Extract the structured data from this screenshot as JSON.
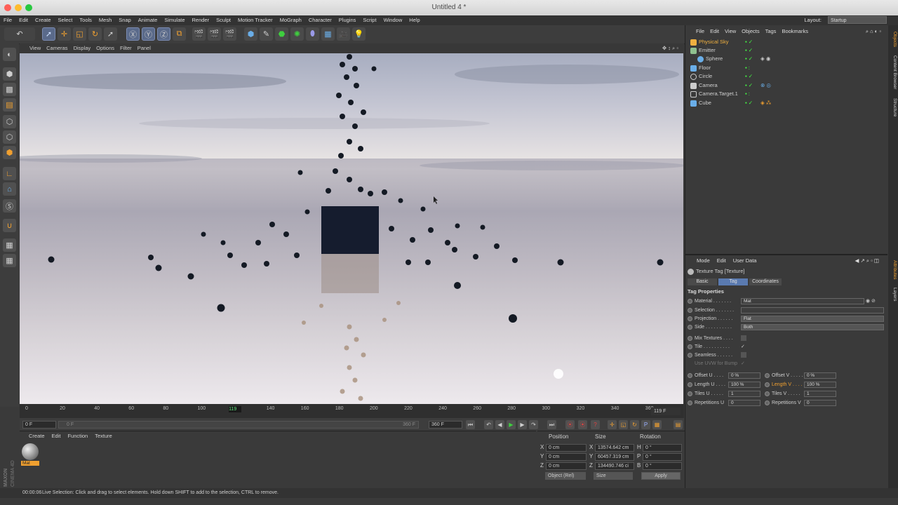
{
  "window": {
    "title": "Untitled 4 *"
  },
  "menu": [
    "File",
    "Edit",
    "Create",
    "Select",
    "Tools",
    "Mesh",
    "Snap",
    "Animate",
    "Simulate",
    "Render",
    "Sculpt",
    "Motion Tracker",
    "MoGraph",
    "Character",
    "Plugins",
    "Script",
    "Window",
    "Help"
  ],
  "layout": {
    "label": "Layout:",
    "value": "Startup"
  },
  "viewport_menu": [
    "View",
    "Cameras",
    "Display",
    "Options",
    "Filter",
    "Panel"
  ],
  "timeline": {
    "ticks": [
      "0",
      "20",
      "40",
      "60",
      "80",
      "100",
      "120",
      "140",
      "160",
      "180",
      "200",
      "220",
      "240",
      "260",
      "280",
      "300",
      "320",
      "340",
      "360"
    ],
    "current_marker": "119",
    "frame_display": "119 F",
    "current_frame": 119,
    "max_frame": 360
  },
  "playbar": {
    "start_field": "0 F",
    "range_start": "0 F",
    "range_end": "360 F",
    "end_field": "360 F"
  },
  "material_manager": {
    "menu": [
      "Create",
      "Edit",
      "Function",
      "Texture"
    ],
    "material_name": "Mat"
  },
  "coordinates": {
    "headers": [
      "Position",
      "Size",
      "Rotation"
    ],
    "rows": [
      {
        "axis": "X",
        "pos": "0 cm",
        "size_axis": "X",
        "size": "13574.642 cm",
        "rot_axis": "H",
        "rot": "0 °"
      },
      {
        "axis": "Y",
        "pos": "0 cm",
        "size_axis": "Y",
        "size": "60457.319 cm",
        "rot_axis": "P",
        "rot": "0 °"
      },
      {
        "axis": "Z",
        "pos": "0 cm",
        "size_axis": "Z",
        "size": "134490.746 ci",
        "rot_axis": "B",
        "rot": "0 °"
      }
    ],
    "mode_select": "Object (Rel)",
    "size_select": "Size",
    "apply": "Apply"
  },
  "status": {
    "time": "00:00:06",
    "message": "Live Selection: Click and drag to select elements. Hold down SHIFT to add to the selection, CTRL to remove."
  },
  "brand": {
    "line1": "MAXON",
    "line2": "CINEMA 4D"
  },
  "object_manager": {
    "menu": [
      "File",
      "Edit",
      "View",
      "Objects",
      "Tags",
      "Bookmarks"
    ],
    "objects": [
      {
        "name": "Physical Sky",
        "color": "#f0b040",
        "highlight": true
      },
      {
        "name": "Emitter",
        "color": "#8fc08f"
      },
      {
        "name": "Sphere",
        "color": "#6aaee8"
      },
      {
        "name": "Floor",
        "color": "#6aaee8"
      },
      {
        "name": "Circle",
        "color": "#cccccc"
      },
      {
        "name": "Camera",
        "color": "#cccccc"
      },
      {
        "name": "Camera.Target.1",
        "color": "#cccccc"
      },
      {
        "name": "Cube",
        "color": "#6aaee8"
      }
    ]
  },
  "side_tabs": [
    "Objects",
    "Content Browser",
    "Structure",
    "Attributes",
    "Layers"
  ],
  "attributes": {
    "menu": [
      "Mode",
      "Edit",
      "User Data"
    ],
    "object_title": "Texture Tag [Texture]",
    "tabs": [
      "Basic",
      "Tag",
      "Coordinates"
    ],
    "section": "Tag Properties",
    "material": {
      "label": "Material . . . . . . .",
      "value": "Mat"
    },
    "selection": {
      "label": "Selection . . . . . . .",
      "value": ""
    },
    "projection": {
      "label": "Projection . . . . . .",
      "value": "Flat"
    },
    "side": {
      "label": "Side . . . . . . . . . .",
      "value": "Both"
    },
    "checks": [
      {
        "label": "Mix Textures . . . .",
        "value": ""
      },
      {
        "label": "Tile . . . . . . . . . .",
        "value": "✓"
      },
      {
        "label": "Seamless . . . . . .",
        "value": ""
      },
      {
        "label": "Use UVW for Bump",
        "value": "✓"
      }
    ],
    "offset_u": {
      "label": "Offset U . . . .",
      "value": "0 %"
    },
    "offset_v": {
      "label": "Offset V . . . . .",
      "value": "0 %"
    },
    "length_u": {
      "label": "Length U . . . .",
      "value": "100 %"
    },
    "length_v": {
      "label": "Length V . . . .",
      "value": "100 %"
    },
    "tiles_u": {
      "label": "Tiles U . . . . .",
      "value": "1"
    },
    "tiles_v": {
      "label": "Tiles V . . . . .",
      "value": "1"
    },
    "rep_u": {
      "label": "Repetitions U",
      "value": "0"
    },
    "rep_v": {
      "label": "Repetitions V",
      "value": "0"
    }
  },
  "colors": {
    "accent": "#f0a030",
    "selection": "#5a7ab0"
  }
}
